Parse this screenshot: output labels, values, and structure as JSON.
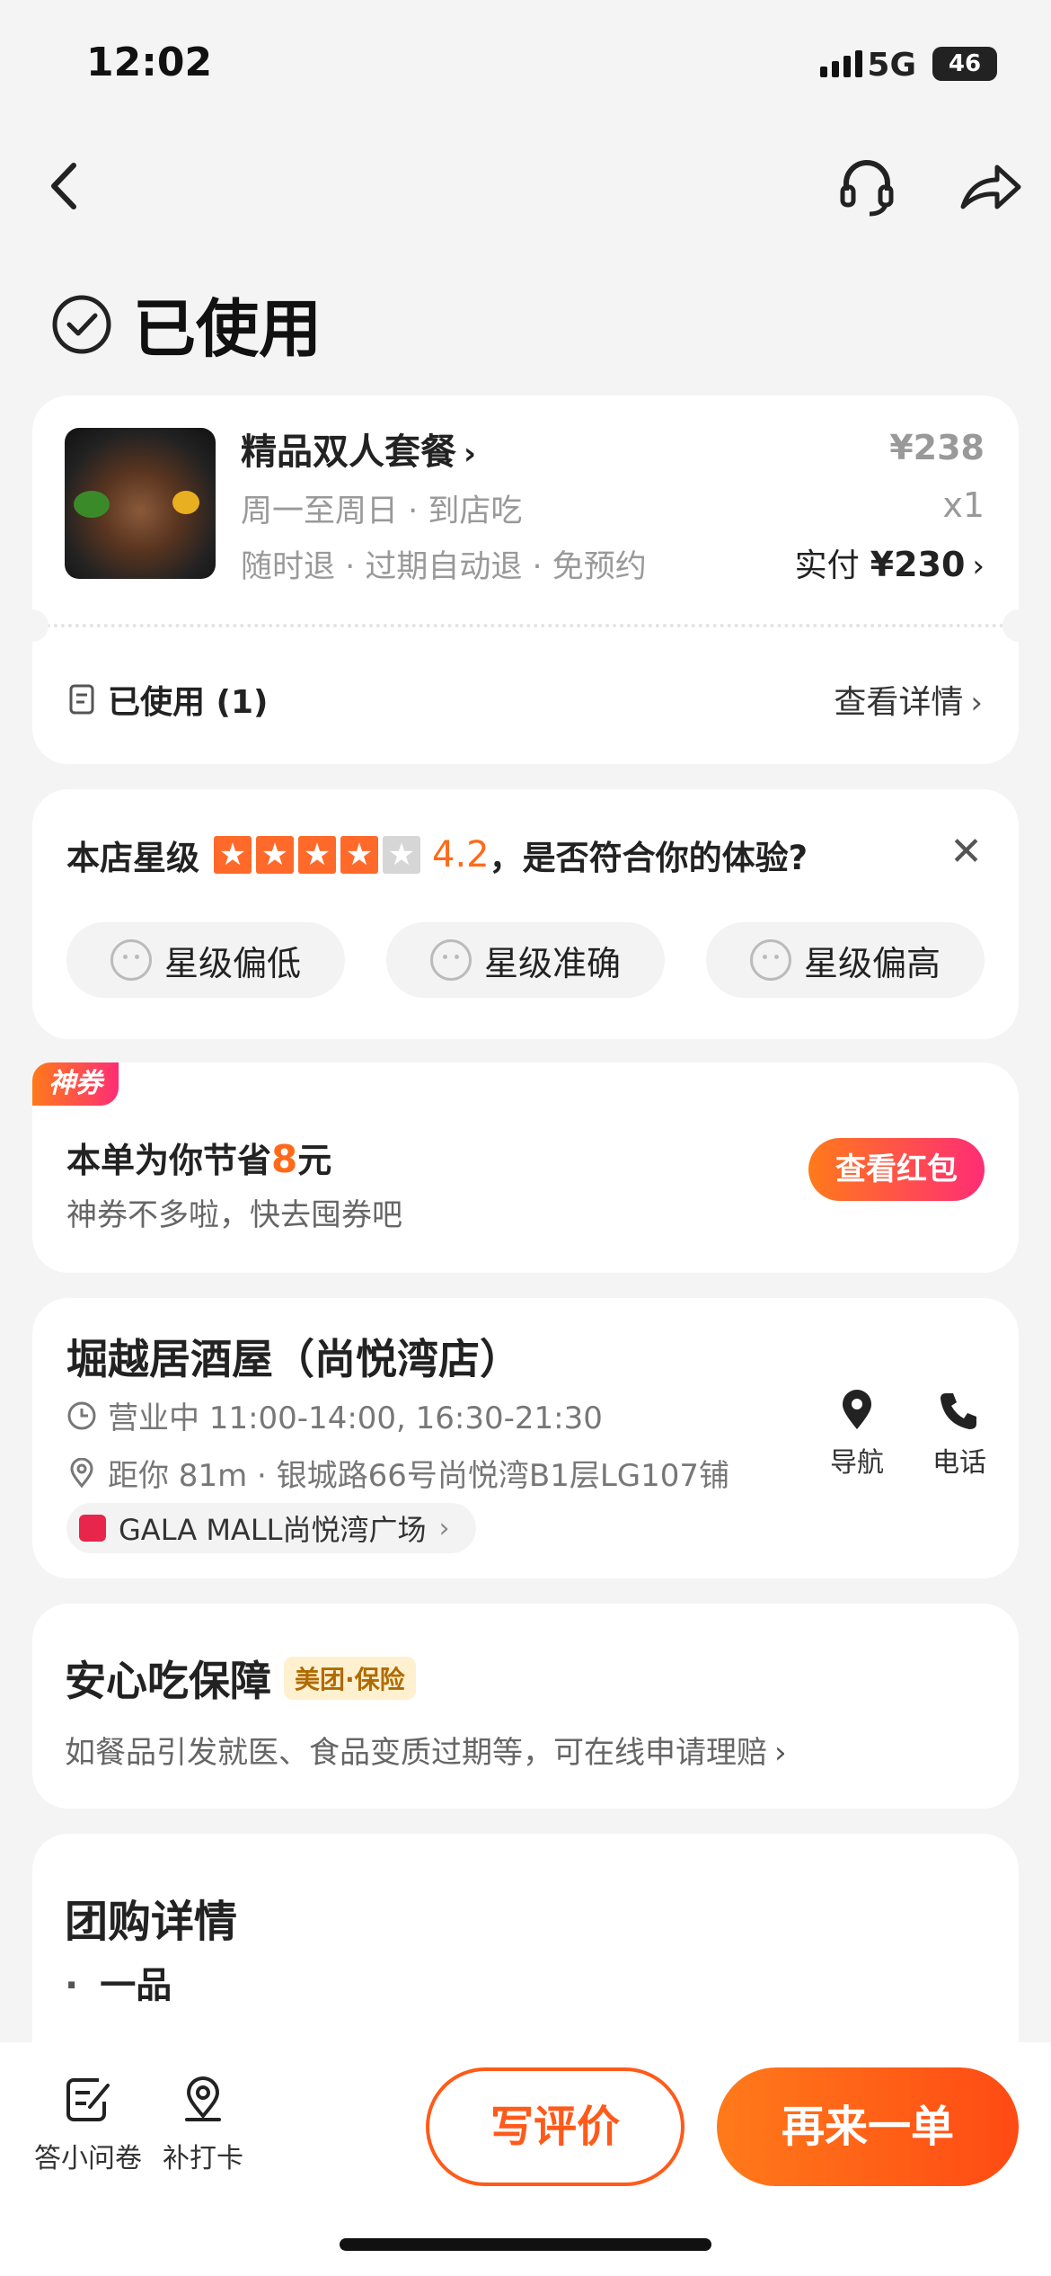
{
  "status": {
    "time": "12:02",
    "network": "5G",
    "battery": "46"
  },
  "page": {
    "title": "已使用"
  },
  "order": {
    "name": "精品双人套餐",
    "schedule": "周一至周日 · 到店吃",
    "policy": "随时退 · 过期自动退 · 免预约",
    "price": "¥238",
    "qty": "x1",
    "paid_label": "实付",
    "paid_value": "¥230",
    "used_label": "已使用 (1)",
    "detail_link": "查看详情"
  },
  "rating": {
    "label": "本店星级",
    "score": "4.2",
    "stars": 4,
    "question": "，是否符合你的体验?",
    "options": [
      "星级偏低",
      "星级准确",
      "星级偏高"
    ]
  },
  "coupon": {
    "tag": "神券",
    "save_prefix": "本单为你节省",
    "save_amount": "8",
    "save_suffix": "元",
    "sub": "神券不多啦，快去囤券吧",
    "button": "查看红包"
  },
  "store": {
    "name": "堀越居酒屋（尚悦湾店）",
    "hours": "营业中 11:00-14:00, 16:30-21:30",
    "distance": "距你 81m · 银城路66号尚悦湾B1层LG107铺",
    "mall": "GALA MALL尚悦湾广场",
    "nav_label": "导航",
    "phone_label": "电话"
  },
  "guarantee": {
    "title": "安心吃保障",
    "badge": "美团·保险",
    "desc": "如餐品引发就医、食品变质过期等，可在线申请理赔"
  },
  "group": {
    "title": "团购详情",
    "item": "一品"
  },
  "bottom": {
    "survey": "答小问卷",
    "checkin": "补打卡",
    "review": "写评价",
    "reorder": "再来一单"
  },
  "colors": {
    "accent": "#ff6a1a",
    "pink": "#ff2d75"
  }
}
